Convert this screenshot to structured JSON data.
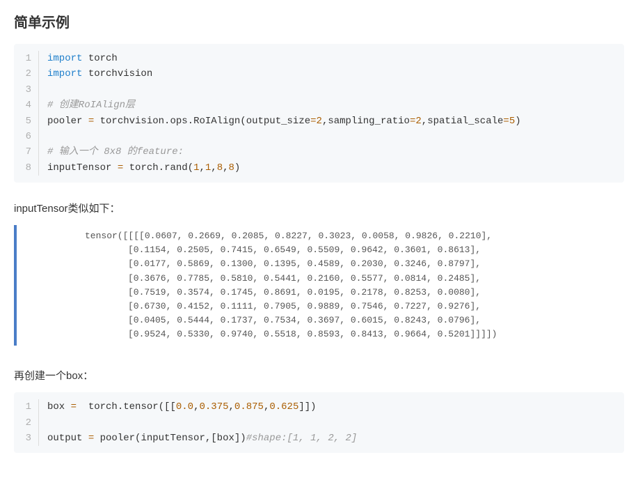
{
  "heading": "简单示例",
  "code1": {
    "lines": [
      {
        "n": "1",
        "tokens": [
          {
            "c": "kw",
            "t": "import"
          },
          {
            "c": "name",
            "t": " torch"
          }
        ]
      },
      {
        "n": "2",
        "tokens": [
          {
            "c": "kw",
            "t": "import"
          },
          {
            "c": "name",
            "t": " torchvision"
          }
        ]
      },
      {
        "n": "3",
        "tokens": []
      },
      {
        "n": "4",
        "tokens": [
          {
            "c": "comment",
            "t": "# 创建RoIAlign层"
          }
        ]
      },
      {
        "n": "5",
        "tokens": [
          {
            "c": "name",
            "t": "pooler "
          },
          {
            "c": "op",
            "t": "="
          },
          {
            "c": "name",
            "t": " torchvision"
          },
          {
            "c": "punct",
            "t": "."
          },
          {
            "c": "name",
            "t": "ops"
          },
          {
            "c": "punct",
            "t": "."
          },
          {
            "c": "name",
            "t": "RoIAlign"
          },
          {
            "c": "punct",
            "t": "("
          },
          {
            "c": "param",
            "t": "output_size"
          },
          {
            "c": "op",
            "t": "="
          },
          {
            "c": "num",
            "t": "2"
          },
          {
            "c": "punct",
            "t": ","
          },
          {
            "c": "param",
            "t": "sampling_ratio"
          },
          {
            "c": "op",
            "t": "="
          },
          {
            "c": "num",
            "t": "2"
          },
          {
            "c": "punct",
            "t": ","
          },
          {
            "c": "param",
            "t": "spatial_scale"
          },
          {
            "c": "op",
            "t": "="
          },
          {
            "c": "num",
            "t": "5"
          },
          {
            "c": "punct",
            "t": ")"
          }
        ]
      },
      {
        "n": "6",
        "tokens": []
      },
      {
        "n": "7",
        "tokens": [
          {
            "c": "comment",
            "t": "# 输入一个 8x8 的feature:"
          }
        ]
      },
      {
        "n": "8",
        "tokens": [
          {
            "c": "name",
            "t": "inputTensor "
          },
          {
            "c": "op",
            "t": "="
          },
          {
            "c": "name",
            "t": " torch"
          },
          {
            "c": "punct",
            "t": "."
          },
          {
            "c": "name",
            "t": "rand"
          },
          {
            "c": "punct",
            "t": "("
          },
          {
            "c": "num",
            "t": "1"
          },
          {
            "c": "punct",
            "t": ","
          },
          {
            "c": "num",
            "t": "1"
          },
          {
            "c": "punct",
            "t": ","
          },
          {
            "c": "num",
            "t": "8"
          },
          {
            "c": "punct",
            "t": ","
          },
          {
            "c": "num",
            "t": "8"
          },
          {
            "c": "punct",
            "t": ")"
          }
        ]
      }
    ]
  },
  "para1": "inputTensor类似如下：",
  "tensor": {
    "prefix": "tensor([[[[",
    "rows": [
      "[0.0607, 0.2669, 0.2085, 0.8227, 0.3023, 0.0058, 0.9826, 0.2210],",
      "[0.1154, 0.2505, 0.7415, 0.6549, 0.5509, 0.9642, 0.3601, 0.8613],",
      "[0.0177, 0.5869, 0.1300, 0.1395, 0.4589, 0.2030, 0.3246, 0.8797],",
      "[0.3676, 0.7785, 0.5810, 0.5441, 0.2160, 0.5577, 0.0814, 0.2485],",
      "[0.7519, 0.3574, 0.1745, 0.8691, 0.0195, 0.2178, 0.8253, 0.0080],",
      "[0.6730, 0.4152, 0.1111, 0.7905, 0.9889, 0.7546, 0.7227, 0.9276],",
      "[0.0405, 0.5444, 0.1737, 0.7534, 0.3697, 0.6015, 0.8243, 0.0796],",
      "[0.9524, 0.5330, 0.9740, 0.5518, 0.8593, 0.8413, 0.9664, 0.5201]]]])"
    ]
  },
  "para2": "再创建一个box：",
  "code2": {
    "lines": [
      {
        "n": "1",
        "tokens": [
          {
            "c": "name",
            "t": "box "
          },
          {
            "c": "op",
            "t": "="
          },
          {
            "c": "name",
            "t": "  torch"
          },
          {
            "c": "punct",
            "t": "."
          },
          {
            "c": "name",
            "t": "tensor"
          },
          {
            "c": "punct",
            "t": "([["
          },
          {
            "c": "num",
            "t": "0.0"
          },
          {
            "c": "punct",
            "t": ","
          },
          {
            "c": "num",
            "t": "0.375"
          },
          {
            "c": "punct",
            "t": ","
          },
          {
            "c": "num",
            "t": "0.875"
          },
          {
            "c": "punct",
            "t": ","
          },
          {
            "c": "num",
            "t": "0.625"
          },
          {
            "c": "punct",
            "t": "]])"
          }
        ]
      },
      {
        "n": "2",
        "tokens": []
      },
      {
        "n": "3",
        "tokens": [
          {
            "c": "name",
            "t": "output "
          },
          {
            "c": "op",
            "t": "="
          },
          {
            "c": "name",
            "t": " pooler"
          },
          {
            "c": "punct",
            "t": "("
          },
          {
            "c": "name",
            "t": "inputTensor"
          },
          {
            "c": "punct",
            "t": ",["
          },
          {
            "c": "name",
            "t": "box"
          },
          {
            "c": "punct",
            "t": "])"
          },
          {
            "c": "comment",
            "t": "#shape:[1, 1, 2, 2]"
          }
        ]
      }
    ]
  }
}
